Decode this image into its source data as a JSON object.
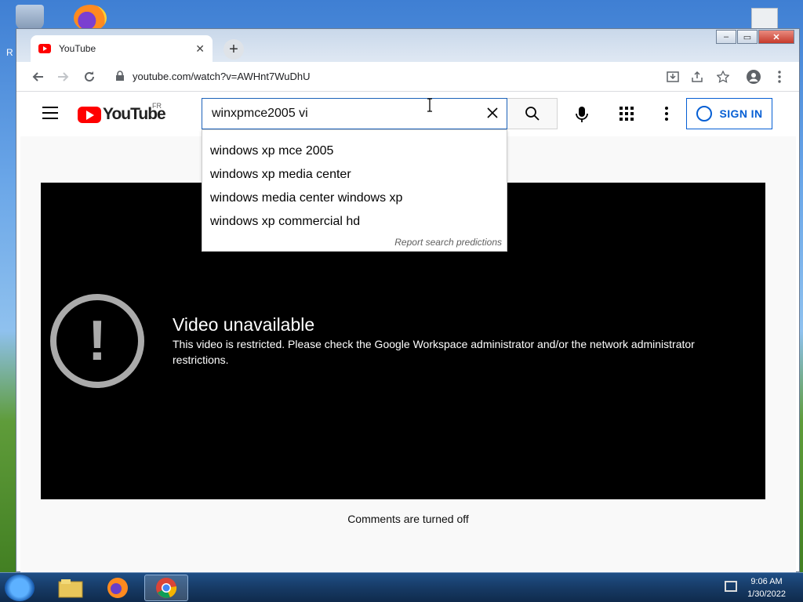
{
  "desktop": {
    "partial_label": "R"
  },
  "browser": {
    "tab_title": "YouTube",
    "new_tab_symbol": "+",
    "close_symbol": "✕",
    "url": "youtube.com/watch?v=AWHnt7WuDhU",
    "window_controls": {
      "minimize": "–",
      "maximize": "▭",
      "close": "✕"
    }
  },
  "youtube": {
    "logo_text": "YouTube",
    "region": "FR",
    "search_value": "winxpmce2005 vi",
    "suggestions": [
      "windows xp mce 2005",
      "windows xp media center",
      "windows media center windows xp",
      "windows xp commercial hd"
    ],
    "report_text": "Report search predictions",
    "sign_in": "SIGN IN",
    "player": {
      "alert_symbol": "!",
      "title": "Video unavailable",
      "message": "This video is restricted. Please check the Google Workspace administrator and/or the network administrator restrictions."
    },
    "comments_status": "Comments are turned off"
  },
  "taskbar": {
    "time": "9:06 AM",
    "date": "1/30/2022"
  },
  "colors": {
    "yt_red": "#ff0000",
    "signin_blue": "#065fd4",
    "search_focus": "#1c62b9"
  }
}
